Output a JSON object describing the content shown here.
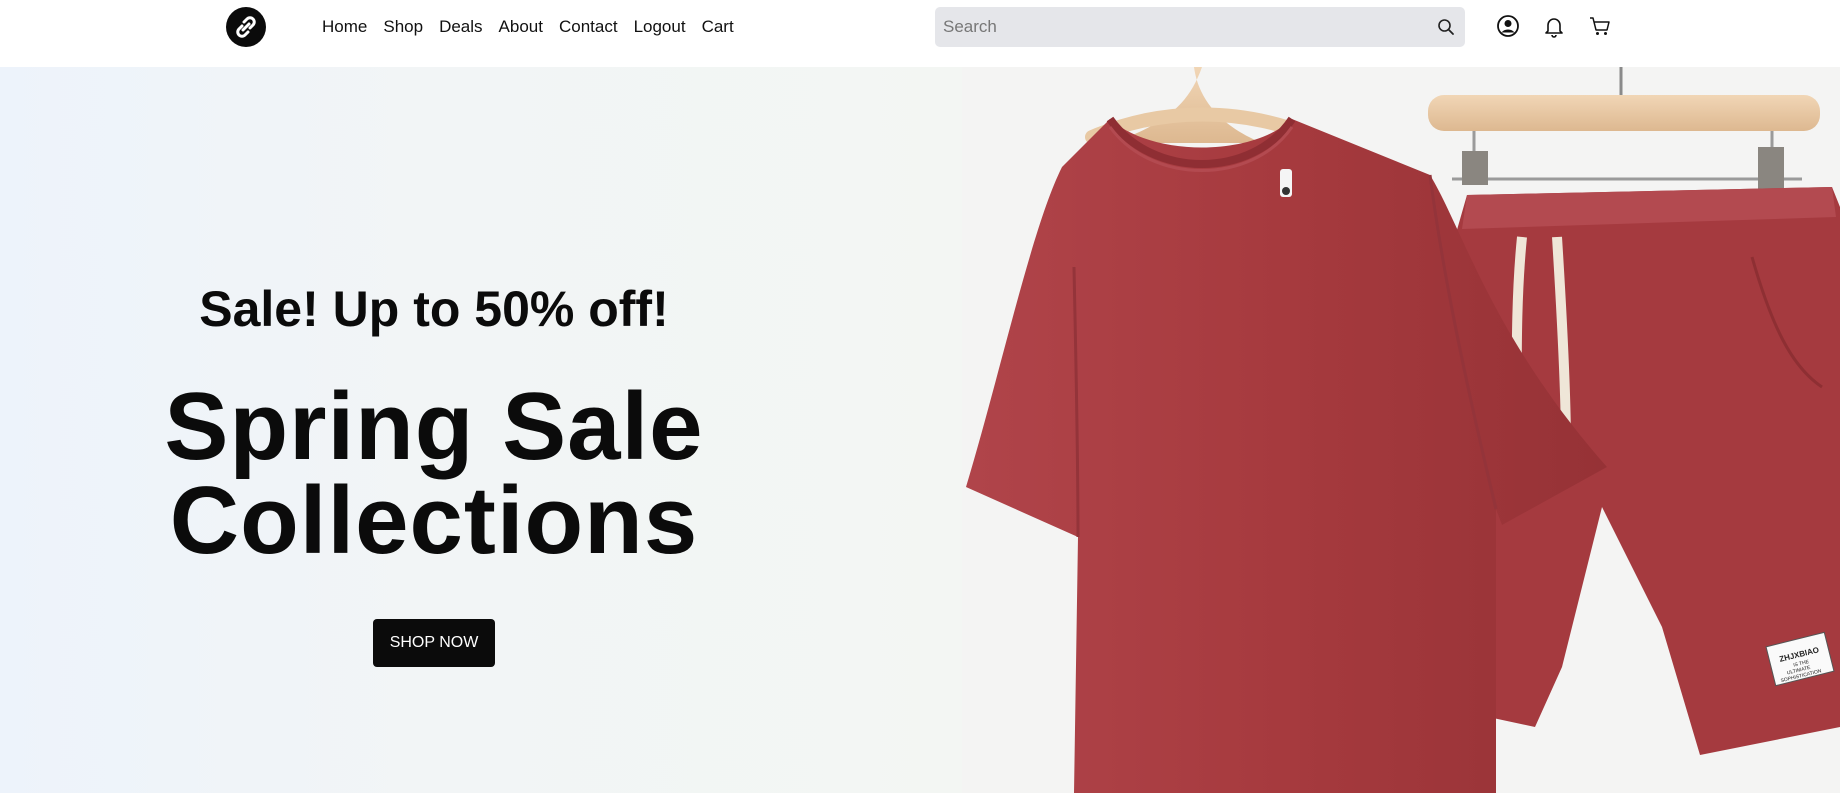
{
  "header": {
    "logo_icon": "link-chain-icon",
    "nav": [
      "Home",
      "Shop",
      "Deals",
      "About",
      "Contact",
      "Logout",
      "Cart"
    ],
    "search": {
      "placeholder": "Search",
      "value": "",
      "icon": "search-icon"
    },
    "icons": [
      "user-account-icon",
      "bell-icon",
      "shopping-cart-icon"
    ]
  },
  "hero": {
    "subtitle": "Sale! Up to 50% off!",
    "title_line1": "Spring Sale",
    "title_line2": "Collections",
    "cta": "SHOP NOW",
    "image": "red t-shirt and shorts set on wooden hangers",
    "shorts_tag": [
      "ZHJXBIAO",
      "IS THE",
      "ULTIMATE",
      "SOPHISTICATION"
    ]
  },
  "colors": {
    "accent": "#0b0b0b",
    "search_bg": "#e5e6ea",
    "garment": "#a63a3e"
  }
}
